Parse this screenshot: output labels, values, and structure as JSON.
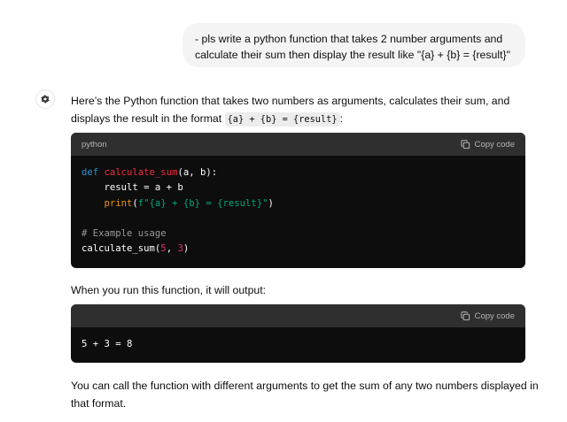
{
  "user_message": {
    "line1": "- pls write a python function that takes 2 number arguments and",
    "line2": "calculate their sum then display the result like \"{a} + {b} = {result}\""
  },
  "assistant": {
    "intro_line1": "Here’s the Python function that takes two numbers as arguments, calculates their sum, and",
    "intro_line2_prefix": "displays the result in the format",
    "intro_inline_code": "{a} + {b} = {result}",
    "intro_line2_suffix": ":",
    "code1": {
      "language": "python",
      "copy_label": "Copy code",
      "tokens": {
        "def": "def",
        "func_name": "calculate_sum",
        "params": "(a, b):",
        "line2": "    result = a + b",
        "indent": "    ",
        "print": "print",
        "open_paren": "(",
        "fstring": "f\"{a} + {b} = {result}\"",
        "close_paren": ")",
        "comment": "# Example usage",
        "call": "calculate_sum(",
        "arg1": "5",
        "comma": ", ",
        "arg2": "3",
        "call_close": ")"
      }
    },
    "middle_text": "When you run this function, it will output:",
    "code2": {
      "language": "",
      "copy_label": "Copy code",
      "output": "5 + 3 = 8"
    },
    "outro_line1": "You can call the function with different arguments to get the sum of any two numbers displayed in",
    "outro_line2": "that format."
  }
}
